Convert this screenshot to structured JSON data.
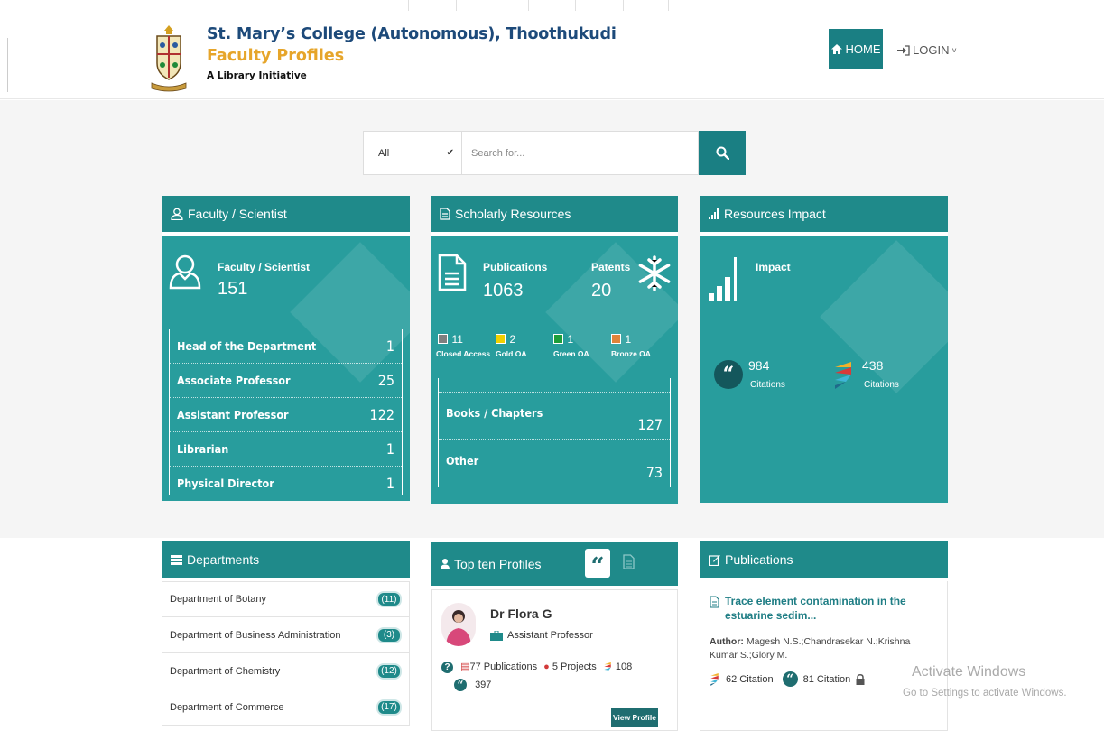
{
  "header": {
    "college": "St. Mary’s College (Autonomous), Thoothukudi",
    "subtitle": "Faculty Profiles",
    "tagline": "A Library Initiative",
    "nav": {
      "home": "HOME",
      "login": "LOGIN"
    }
  },
  "search": {
    "filter_value": "All",
    "placeholder": "Search for..."
  },
  "faculty_card": {
    "title": "Faculty / Scientist",
    "label": "Faculty / Scientist",
    "count": "151",
    "roles": [
      {
        "label": "Head of the Department",
        "value": "1"
      },
      {
        "label": "Associate Professor",
        "value": "25"
      },
      {
        "label": "Assistant Professor",
        "value": "122"
      },
      {
        "label": "Librarian",
        "value": "1"
      },
      {
        "label": "Physical Director",
        "value": "1"
      }
    ]
  },
  "scholarly_card": {
    "title": "Scholarly Resources",
    "publications_label": "Publications",
    "publications_count": "1063",
    "patents_label": "Patents",
    "patents_count": "20",
    "access": [
      {
        "count": "11",
        "label": "Closed Access",
        "color": "#7f7f7f"
      },
      {
        "count": "2",
        "label": "Gold OA",
        "color": "#f0d000"
      },
      {
        "count": "1",
        "label": "Green OA",
        "color": "#1e9e3a"
      },
      {
        "count": "1",
        "label": "Bronze OA",
        "color": "#e0843b"
      }
    ],
    "rows": [
      {
        "label": "Books / Chapters",
        "value": "127"
      },
      {
        "label": "Other",
        "value": "73"
      }
    ]
  },
  "impact_card": {
    "title": "Resources Impact",
    "label": "Impact",
    "citations": [
      {
        "value": "984",
        "label": "Citations"
      },
      {
        "value": "438",
        "label": "Citations"
      }
    ]
  },
  "departments": {
    "title": "Departments",
    "items": [
      {
        "name": "Department of Botany",
        "count": "(11)"
      },
      {
        "name": "Department of Business Administration",
        "count": "(3)"
      },
      {
        "name": "Department of Chemistry",
        "count": "(12)"
      },
      {
        "name": "Department of Commerce",
        "count": "(17)"
      }
    ]
  },
  "top_profiles": {
    "title": "Top ten Profiles",
    "profile": {
      "name": "Dr Flora G",
      "role": "Assistant Professor",
      "publications": "77 Publications",
      "projects": "5 Projects",
      "crossref": "108",
      "citations": "397",
      "button": "View Profile"
    }
  },
  "publications": {
    "title": "Publications",
    "item_title": "Trace element contamination in the estuarine sedim...",
    "author_label": "Author:",
    "authors": "Magesh N.S.;Chandrasekar N.;Krishna Kumar S.;Glory M.",
    "crossref_citation": "62 Citation",
    "scholar_citation": "81 Citation"
  },
  "watermark": {
    "title": "Activate Windows",
    "subtitle": "Go to Settings to activate Windows."
  },
  "colors": {
    "teal_header": "#1f8a8a",
    "teal_body": "#289d9d",
    "brand_blue": "#1d4a7a",
    "brand_gold": "#e6a52a"
  }
}
